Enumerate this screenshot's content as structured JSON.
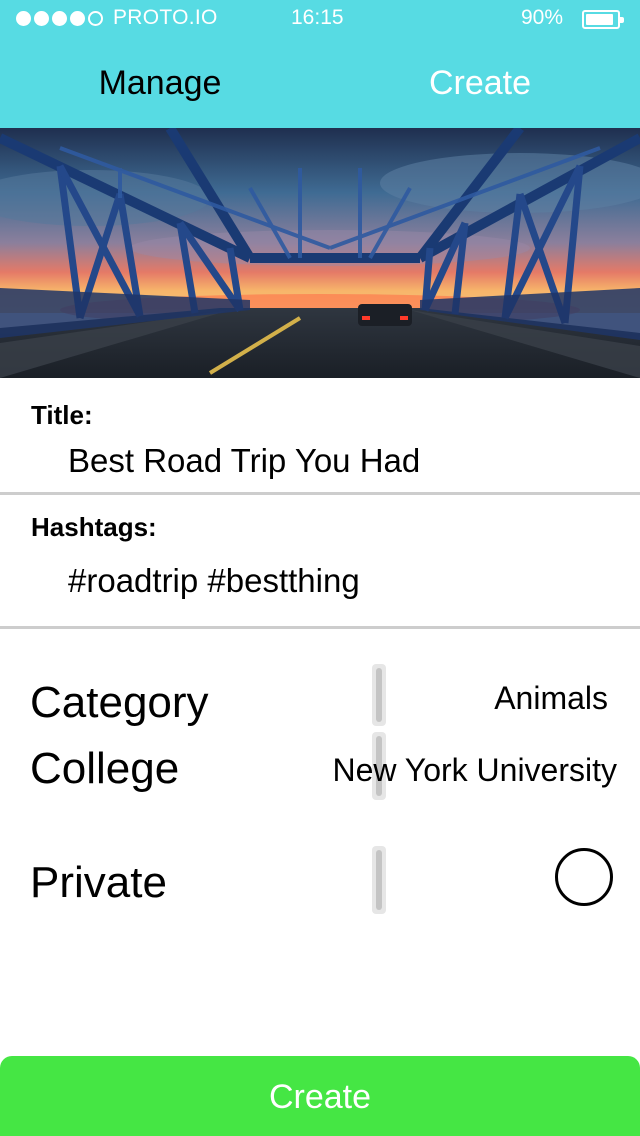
{
  "status_bar": {
    "carrier": "PROTO.IO",
    "time": "16:15",
    "battery": "90%",
    "battery_level": 0.9,
    "signal_dots_filled": 4,
    "signal_dots_total": 5
  },
  "nav": {
    "manage_label": "Manage",
    "create_label": "Create"
  },
  "hero": {
    "image": "bridge-sunset-photo"
  },
  "form": {
    "title_label": "Title:",
    "title_value": "Best Road Trip You Had",
    "hashtags_label": "Hashtags:",
    "hashtags_value": "#roadtrip #bestthing"
  },
  "options": {
    "category_label": "Category",
    "category_value": "Animals",
    "college_label": "College",
    "college_value": "New York University",
    "private_label": "Private",
    "private_checked": false
  },
  "footer": {
    "create_button_label": "Create"
  },
  "colors": {
    "header": "#57dbe3",
    "create_button": "#45e644",
    "separator": "#cdcdcd"
  }
}
